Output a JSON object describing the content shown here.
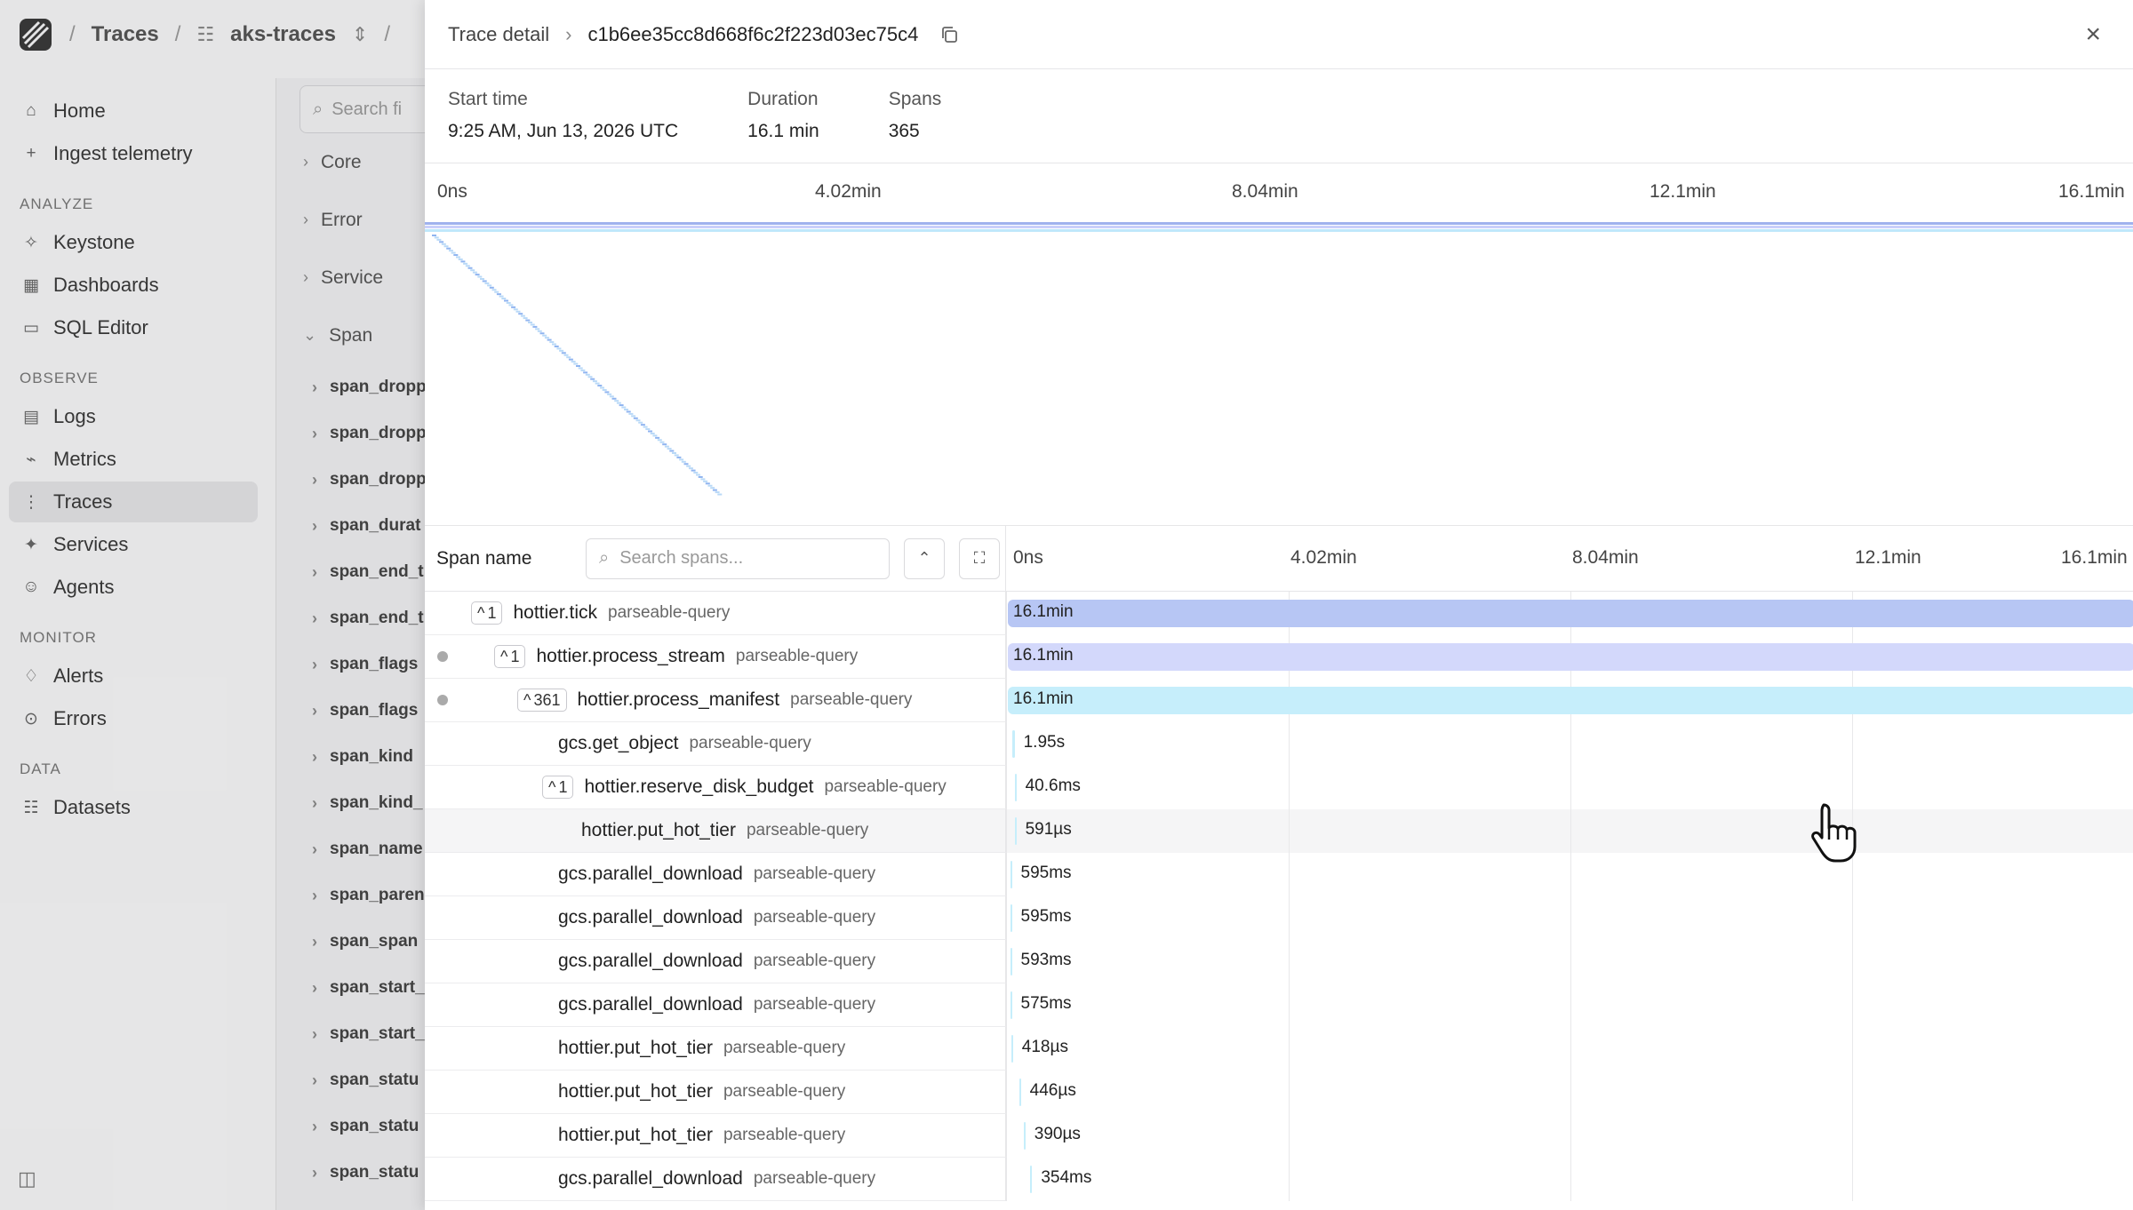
{
  "topbar": {
    "crumb1": "Traces",
    "crumb2": "aks-traces"
  },
  "sidebar": {
    "home": "Home",
    "ingest": "Ingest telemetry",
    "analyze_label": "ANALYZE",
    "analyze": [
      "Keystone",
      "Dashboards",
      "SQL Editor"
    ],
    "observe_label": "OBSERVE",
    "observe": [
      "Logs",
      "Metrics",
      "Traces",
      "Services",
      "Agents"
    ],
    "monitor_label": "MONITOR",
    "monitor": [
      "Alerts",
      "Errors"
    ],
    "data_label": "DATA",
    "data": [
      "Datasets"
    ]
  },
  "filters": {
    "search_placeholder": "Search fi",
    "groups": [
      "Core",
      "Error",
      "Service",
      "Span"
    ],
    "fields": [
      "span_dropp",
      "span_dropp",
      "span_dropp",
      "span_durat",
      "span_end_t",
      "span_end_t",
      "span_flags",
      "span_flags",
      "span_kind",
      "span_kind_",
      "span_name",
      "span_paren",
      "span_span",
      "span_start_",
      "span_start_",
      "span_statu",
      "span_statu",
      "span_statu"
    ]
  },
  "detail": {
    "breadcrumb": "Trace detail",
    "trace_id": "c1b6ee35cc8d668f6c2f223d03ec75c4",
    "start_time_label": "Start time",
    "start_time": "9:25 AM, Jun 13, 2026 UTC",
    "duration_label": "Duration",
    "duration": "16.1 min",
    "spans_label": "Spans",
    "spans": "365"
  },
  "axis": {
    "ticks": [
      "0ns",
      "4.02min",
      "8.04min",
      "12.1min",
      "16.1min"
    ]
  },
  "waterfall": {
    "title": "Span name",
    "search_placeholder": "Search spans...",
    "rows": [
      {
        "name": "hottier.tick",
        "service": "parseable-query",
        "count": "1",
        "duration": "16.1min",
        "start": 0,
        "end": 1,
        "color": "#b7c6f4"
      },
      {
        "name": "hottier.process_stream",
        "service": "parseable-query",
        "count": "1",
        "duration": "16.1min",
        "start": 0,
        "end": 1,
        "color": "#d3d8fb"
      },
      {
        "name": "hottier.process_manifest",
        "service": "parseable-query",
        "count": "361",
        "duration": "16.1min",
        "start": 0,
        "end": 1,
        "color": "#c6eefb"
      },
      {
        "name": "gcs.get_object",
        "service": "parseable-query",
        "count": "",
        "duration": "1.95s",
        "start": 0.004,
        "end": 0.006,
        "color": "#c6eefb"
      },
      {
        "name": "hottier.reserve_disk_budget",
        "service": "parseable-query",
        "count": "1",
        "duration": "40.6ms",
        "start": 0.006,
        "end": 0.007,
        "color": "#c6eefb"
      },
      {
        "name": "hottier.put_hot_tier",
        "service": "parseable-query",
        "count": "",
        "duration": "591µs",
        "start": 0.006,
        "end": 0.007,
        "color": "#c6eefb"
      },
      {
        "name": "gcs.parallel_download",
        "service": "parseable-query",
        "count": "",
        "duration": "595ms",
        "start": 0.002,
        "end": 0.003,
        "color": "#c6eefb"
      },
      {
        "name": "gcs.parallel_download",
        "service": "parseable-query",
        "count": "",
        "duration": "595ms",
        "start": 0.002,
        "end": 0.003,
        "color": "#c6eefb"
      },
      {
        "name": "gcs.parallel_download",
        "service": "parseable-query",
        "count": "",
        "duration": "593ms",
        "start": 0.002,
        "end": 0.003,
        "color": "#c6eefb"
      },
      {
        "name": "gcs.parallel_download",
        "service": "parseable-query",
        "count": "",
        "duration": "575ms",
        "start": 0.002,
        "end": 0.003,
        "color": "#c6eefb"
      },
      {
        "name": "hottier.put_hot_tier",
        "service": "parseable-query",
        "count": "",
        "duration": "418µs",
        "start": 0.003,
        "end": 0.004,
        "color": "#c6eefb"
      },
      {
        "name": "hottier.put_hot_tier",
        "service": "parseable-query",
        "count": "",
        "duration": "446µs",
        "start": 0.01,
        "end": 0.011,
        "color": "#c6eefb"
      },
      {
        "name": "hottier.put_hot_tier",
        "service": "parseable-query",
        "count": "",
        "duration": "390µs",
        "start": 0.014,
        "end": 0.015,
        "color": "#c6eefb"
      },
      {
        "name": "gcs.parallel_download",
        "service": "parseable-query",
        "count": "",
        "duration": "354ms",
        "start": 0.02,
        "end": 0.021,
        "color": "#c6eefb"
      }
    ]
  }
}
